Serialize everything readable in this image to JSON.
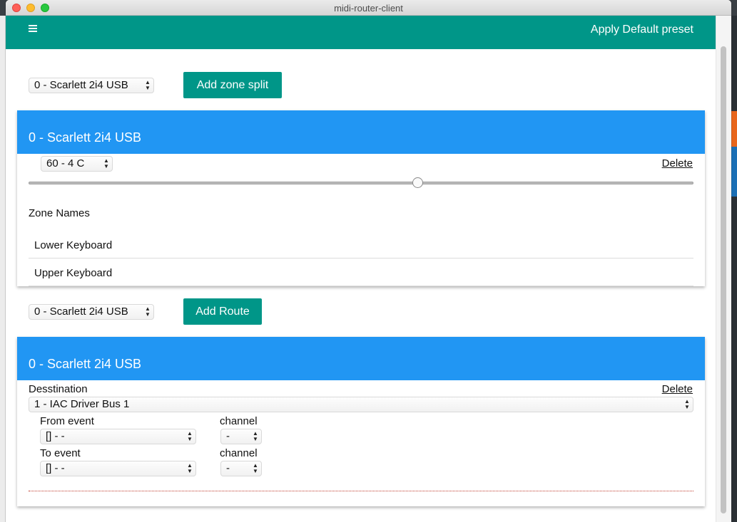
{
  "window": {
    "title": "midi-router-client"
  },
  "appbar": {
    "action_label": "Apply Default preset",
    "menu_icon": "hamburger-menu-icon"
  },
  "zone_split": {
    "device_select": "0 - Scarlett 2i4 USB",
    "add_button": "Add zone split",
    "card": {
      "title": "0 - Scarlett 2i4 USB",
      "note_select": "60 - 4 C",
      "delete_label": "Delete",
      "slider_value_percent": 58.5,
      "zone_names_label": "Zone Names",
      "zones": [
        "Lower Keyboard",
        "Upper Keyboard"
      ]
    }
  },
  "route": {
    "device_select": "0 - Scarlett 2i4 USB",
    "add_button": "Add Route",
    "card": {
      "title": "0 - Scarlett 2i4 USB",
      "destination_label": "Desstination",
      "delete_label": "Delete",
      "destination_select": "1 - IAC Driver Bus 1",
      "from_event_label": "From event",
      "from_event_select": "[] - -",
      "from_channel_label": "channel",
      "from_channel_select": "-",
      "to_event_label": "To event",
      "to_event_select": "[] - -",
      "to_channel_label": "channel",
      "to_channel_select": "-"
    }
  },
  "colors": {
    "teal": "#009688",
    "blue": "#2196f3"
  }
}
